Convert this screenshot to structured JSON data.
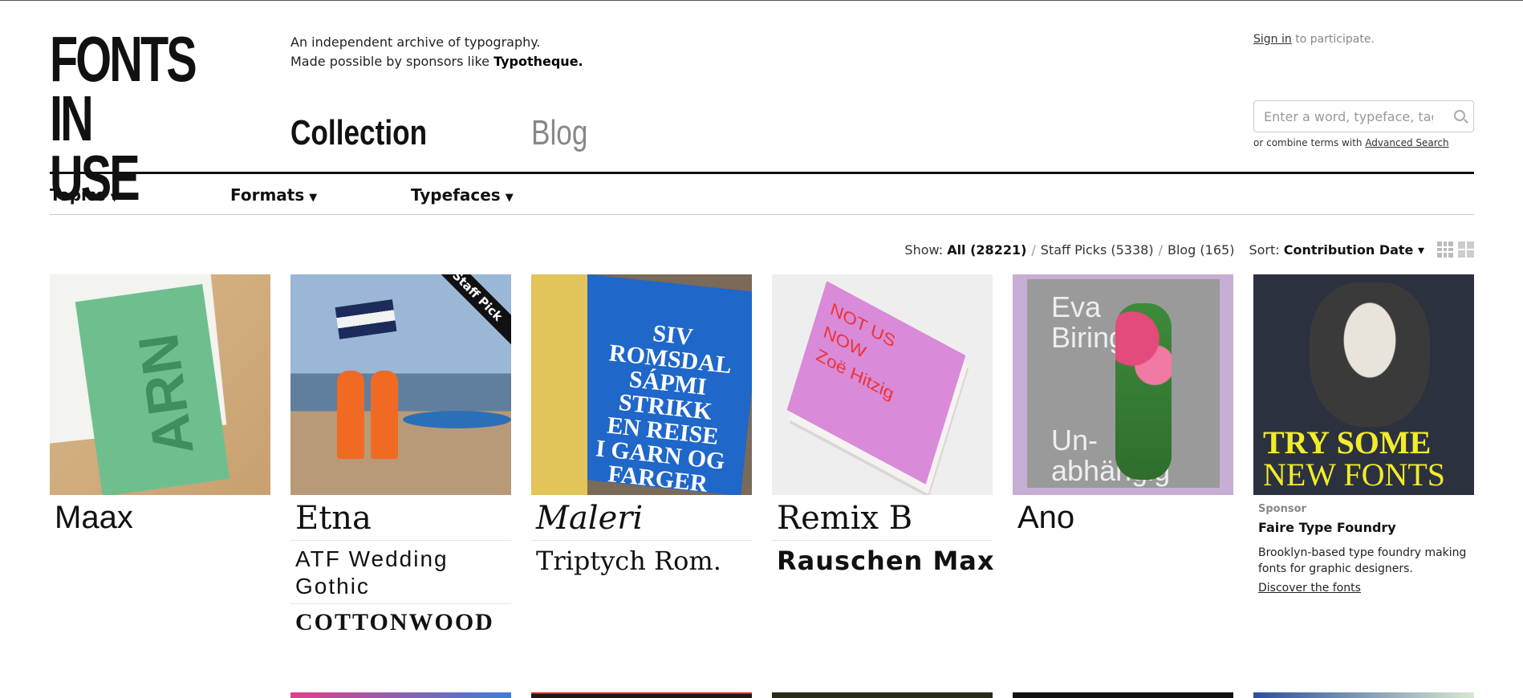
{
  "brand": {
    "logo_line1": "FONTS",
    "logo_line2": "IN USE"
  },
  "tagline": {
    "line1": "An independent archive of typography.",
    "line2_prefix": "Made possible by sponsors like ",
    "line2_sponsor": "Typotheque."
  },
  "main_nav": {
    "collection": "Collection",
    "blog": "Blog"
  },
  "account": {
    "signin_link": "Sign in",
    "signin_suffix": " to participate."
  },
  "search": {
    "placeholder": "Enter a word, typeface, tag …",
    "hint_prefix": "or combine terms with ",
    "hint_link": "Advanced Search"
  },
  "category_nav": [
    {
      "label": "Topics",
      "arrow": "▼"
    },
    {
      "label": "Formats",
      "arrow": "▼"
    },
    {
      "label": "Typefaces",
      "arrow": "▼"
    }
  ],
  "show_bar": {
    "show_label": "Show:",
    "all": "All (28221)",
    "staff_picks": "Staff Picks (5338)",
    "blog": "Blog (165)",
    "sep": "/",
    "sort_label": "Sort:",
    "sort_value": "Contribution Date ▾"
  },
  "cards": [
    {
      "typefaces": [
        "Maax"
      ]
    },
    {
      "badge": "Staff Pick",
      "typefaces": [
        "Etna",
        "ATF Wedding Gothic",
        "COTTONWOOD"
      ]
    },
    {
      "typefaces": [
        "Maleri",
        "Triptych Rom."
      ],
      "cover_lines": [
        "SIV",
        "ROMSDAL",
        "SÁPMI",
        "STRIKK",
        "EN REISE",
        "I GARN OG",
        "FARGER"
      ]
    },
    {
      "typefaces": [
        "Remix B",
        "Rauschen Max"
      ],
      "cover_lines": [
        "NOT US",
        "NOW",
        "Zoë Hitzig"
      ]
    },
    {
      "typefaces": [
        "Ano"
      ],
      "cover_lines": [
        "Eva",
        "Biringer",
        "Un-",
        "abhängig"
      ]
    }
  ],
  "sponsor": {
    "label": "Sponsor",
    "name": "Faire Type Foundry",
    "description": "Brooklyn-based type foundry making fonts for graphic designers.",
    "link": "Discover the fonts",
    "ad_line1": "TRY SOME",
    "ad_line2": "NEW FONTS"
  },
  "colors": {
    "accent_text": "#111111",
    "muted": "#888888",
    "staff_badge": "#111111"
  }
}
